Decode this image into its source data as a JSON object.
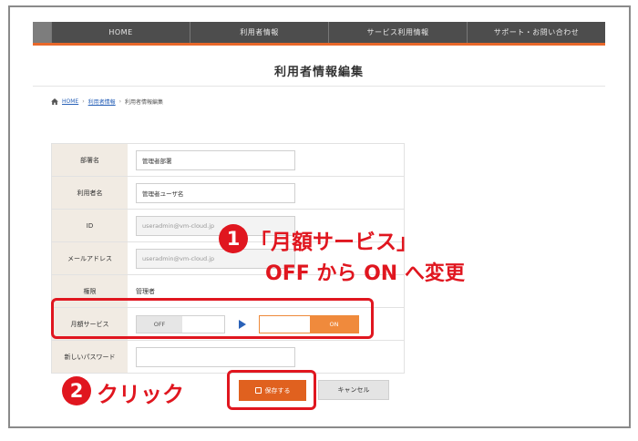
{
  "nav": {
    "items": [
      "HOME",
      "利用者情報",
      "サービス利用情報",
      "サポート・お問い合わせ"
    ]
  },
  "page": {
    "title": "利用者情報編集"
  },
  "breadcrumb": {
    "home": "HOME",
    "separator": "›",
    "level1": "利用者情報",
    "current": "利用者情報編集"
  },
  "form": {
    "rows": [
      {
        "label": "部署名",
        "value": "管理者部署"
      },
      {
        "label": "利用者名",
        "value": "管理者ユーザ名"
      },
      {
        "label": "ID",
        "value": "useradmin@vm-cloud.jp"
      },
      {
        "label": "メールアドレス",
        "value": "useradmin@vm-cloud.jp"
      },
      {
        "label": "権限",
        "value": "管理者"
      },
      {
        "label": "月額サービス",
        "off_label": "OFF",
        "on_label": "ON"
      },
      {
        "label": "新しいパスワード",
        "value": ""
      }
    ]
  },
  "buttons": {
    "save": "保存する",
    "cancel": "キャンセル"
  },
  "annotations": {
    "step1_number": "1",
    "step1_line1": "「月額サービス」",
    "step1_line2": "OFF から ON へ変更",
    "step2_number": "2",
    "step2_text": "クリック"
  },
  "colors": {
    "accent": "#e8672a",
    "annotation_red": "#e0161f",
    "toggle_on": "#f08a3c",
    "nav_bg": "#4d4d4d",
    "label_bg": "#f1ebe3",
    "link_blue": "#2a62b8"
  }
}
